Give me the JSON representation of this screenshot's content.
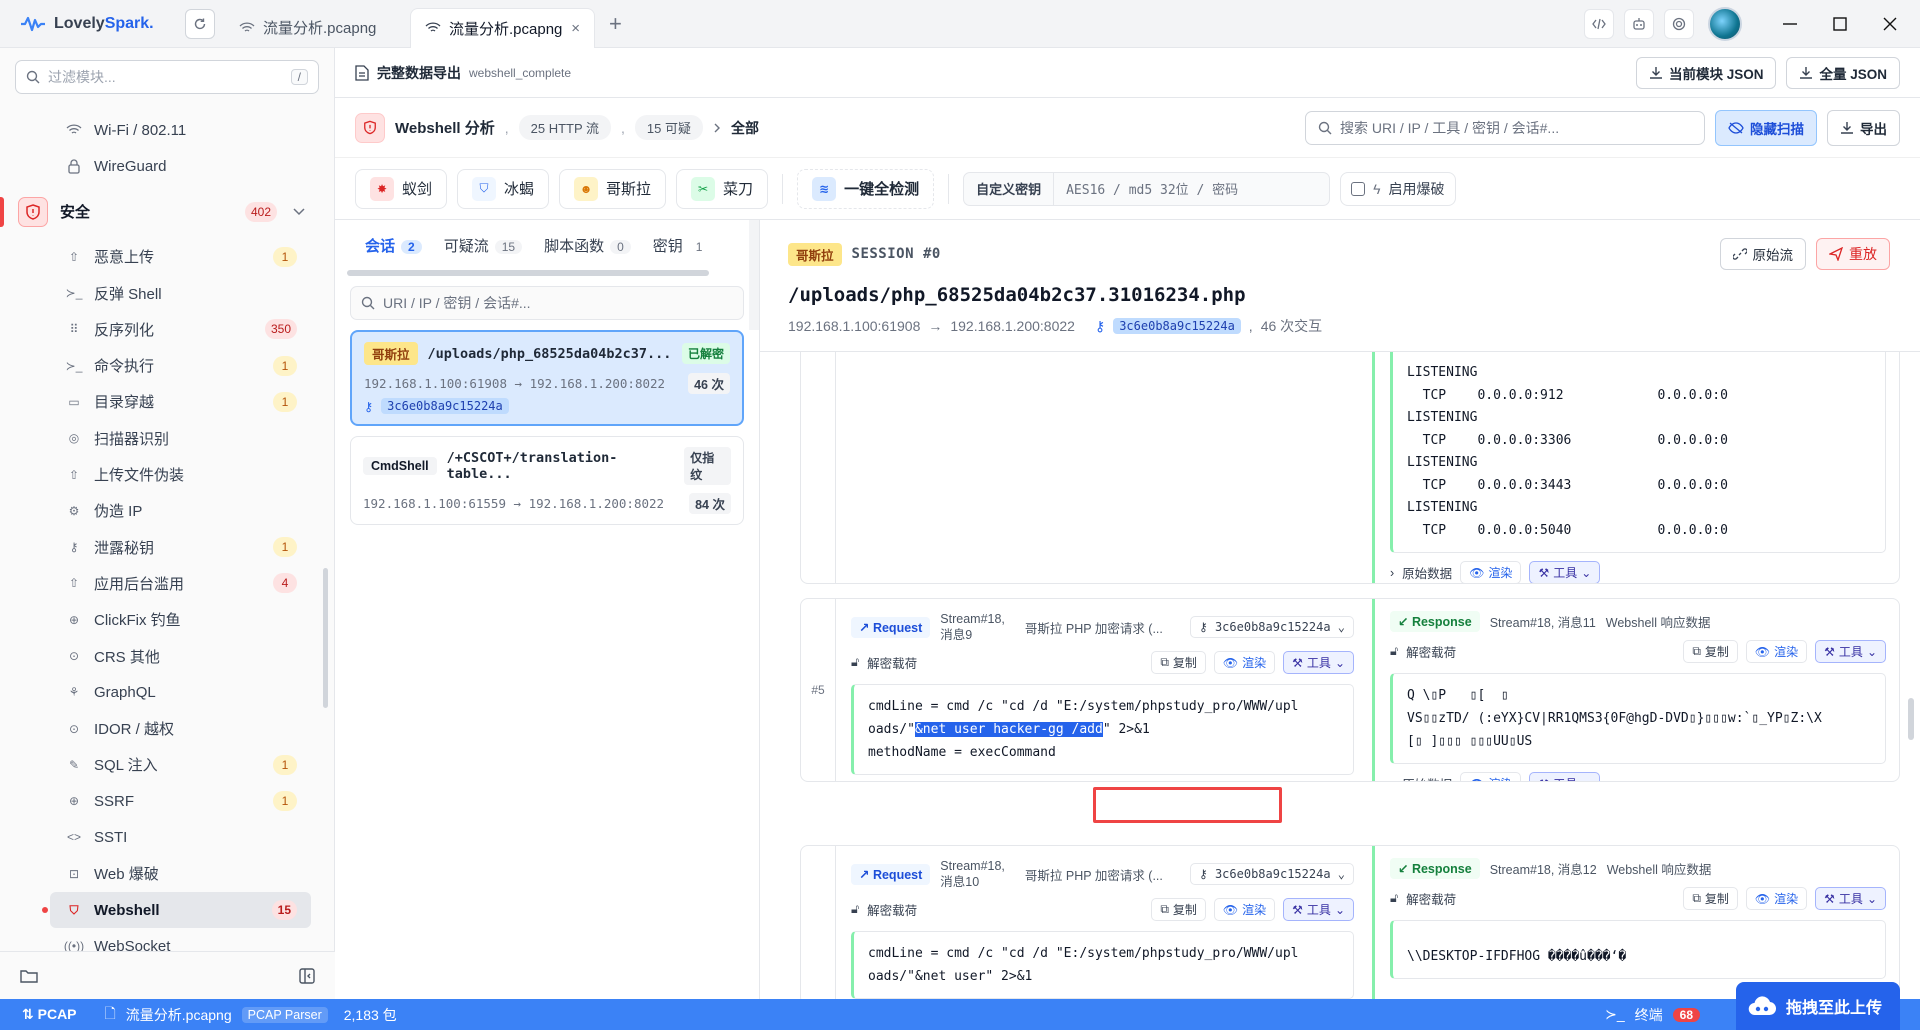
{
  "app": {
    "brand_a": "Lovely",
    "brand_b": "Spark",
    "brand_dot": "."
  },
  "tabs": [
    {
      "label": "流量分析.pcapng"
    },
    {
      "label": "流量分析.pcapng",
      "close": "×"
    }
  ],
  "tab_add": "+",
  "sidebar": {
    "search_placeholder": "过滤模块...",
    "search_kbd": "/",
    "items_top": [
      {
        "label": "Wi-Fi / 802.11",
        "icon": "wifi-icon"
      },
      {
        "label": "WireGuard",
        "icon": "lock-icon"
      }
    ],
    "group": {
      "label": "安全",
      "count": "402"
    },
    "items": [
      {
        "label": "恶意上传",
        "count": "1"
      },
      {
        "label": "反弹 Shell",
        "count": ""
      },
      {
        "label": "反序列化",
        "count": "350"
      },
      {
        "label": "命令执行",
        "count": "1"
      },
      {
        "label": "目录穿越",
        "count": "1"
      },
      {
        "label": "扫描器识别",
        "count": ""
      },
      {
        "label": "上传文件伪装",
        "count": ""
      },
      {
        "label": "伪造 IP",
        "count": ""
      },
      {
        "label": "泄露秘钥",
        "count": "1"
      },
      {
        "label": "应用后台滥用",
        "count": "4"
      },
      {
        "label": "ClickFix 钓鱼",
        "count": ""
      },
      {
        "label": "CRS 其他",
        "count": ""
      },
      {
        "label": "GraphQL",
        "count": ""
      },
      {
        "label": "IDOR / 越权",
        "count": ""
      },
      {
        "label": "SQL 注入",
        "count": "1"
      },
      {
        "label": "SSRF",
        "count": "1"
      },
      {
        "label": "SSTI",
        "count": ""
      },
      {
        "label": "Web 爆破",
        "count": ""
      },
      {
        "label": "Webshell",
        "count": "15"
      },
      {
        "label": "WebSocket",
        "count": ""
      }
    ]
  },
  "export": {
    "title": "完整数据导出",
    "sub": "webshell_complete",
    "btn_current": "当前模块 JSON",
    "btn_all": "全量 JSON"
  },
  "filter": {
    "title": "Webshell 分析",
    "sep": ",",
    "http": "25 HTTP 流",
    "suspicious": "15 可疑",
    "all": "全部",
    "search_placeholder": "搜索 URI / IP / 工具 / 密钥 / 会话#...",
    "hide_scan": "隐藏扫描",
    "export": "导出"
  },
  "tools": {
    "items": [
      "蚁剑",
      "冰蝎",
      "哥斯拉",
      "菜刀"
    ],
    "detect_all": "一键全检测",
    "custom_key": "自定义密钥",
    "key_placeholder": "AES16 / md5 32位 / 密码",
    "brute": "启用爆破"
  },
  "session_tabs": [
    {
      "label": "会话",
      "count": "2"
    },
    {
      "label": "可疑流",
      "count": "15"
    },
    {
      "label": "脚本函数",
      "count": "0"
    },
    {
      "label": "密钥",
      "count": "1"
    }
  ],
  "session_search": "URI / IP / 密钥 / 会话#...",
  "sessions": [
    {
      "tool": "哥斯拉",
      "uri": "/uploads/php_68525da04b2c37...",
      "status": "已解密",
      "src": "192.168.1.100:61908",
      "arrow": "→",
      "dst": "192.168.1.200:8022",
      "count": "46 次",
      "sid": "3c6e0b8a9c15224a"
    },
    {
      "tool": "CmdShell",
      "uri": "/+CSCOT+/translation-table...",
      "status": "仅指纹",
      "src": "192.168.1.100:61559",
      "arrow": "→",
      "dst": "192.168.1.200:8022",
      "count": "84 次"
    }
  ],
  "detail": {
    "tool": "哥斯拉",
    "session_no": "SESSION #0",
    "path": "/uploads/php_68525da04b2c37.31016234.php",
    "src": "192.168.1.100:61908",
    "dst": "192.168.1.200:8022",
    "sid": "3c6e0b8a9c15224a",
    "sep": ",",
    "interactions": "46 次交互",
    "btn_raw": "原始流",
    "btn_replay": "重放"
  },
  "block0": {
    "response_text": "LISTENING\n  TCP    0.0.0.0:912            0.0.0.0:0\nLISTENING\n  TCP    0.0.0.0:3306           0.0.0.0:0\nLISTENING\n  TCP    0.0.0.0:3443           0.0.0.0:0\nLISTENING\n  TCP    0.0.0.0:5040           0.0.0.0:0",
    "raw": "原始数据",
    "render": "渲染",
    "tools": "工具"
  },
  "block1": {
    "index": "#5",
    "req_label": "Request",
    "req_stream_a": "Stream#18,",
    "req_stream_b": "消息9",
    "req_desc": "哥斯拉 PHP 加密请求 (...",
    "sid": "3c6e0b8a9c15224a",
    "decrypted": "解密载荷",
    "copy": "复制",
    "render": "渲染",
    "tools": "工具",
    "code_a": "cmdLine = cmd /c \"cd /d \"E:/system/phpstudy_pro/WWW/upl\noads/\"",
    "code_hl": "&net user hacker-gg /add",
    "code_b": "\" 2>&1\nmethodName = execCommand",
    "raw": "原始数据",
    "res_label": "Response",
    "res_stream": "Stream#18, 消息11",
    "res_desc": "Webshell 响应数据",
    "res_text": "Q \\▯P   ▯[  ▯\nVS▯▯zTD/ (:eYX}CV|RR1QMS3{0F@hgD-DVD▯}▯▯▯w:`▯_YP▯Z:\\X\n[▯ ]▯▯▯ ▯▯▯UU▯US"
  },
  "block2": {
    "req_label": "Request",
    "req_stream_a": "Stream#18,",
    "req_stream_b": "消息10",
    "req_desc": "哥斯拉 PHP 加密请求 (...",
    "sid": "3c6e0b8a9c15224a",
    "decrypted": "解密载荷",
    "copy": "复制",
    "render": "渲染",
    "tools": "工具",
    "code": "cmdLine = cmd /c \"cd /d \"E:/system/phpstudy_pro/WWW/upl\noads/\"&net user\" 2>&1",
    "res_label": "Response",
    "res_stream": "Stream#18, 消息12",
    "res_desc": "Webshell 响应数据",
    "res_text": "\\\\DESKTOP-IFDFHOG ����û���‘�"
  },
  "status": {
    "pcap": "PCAP",
    "file": "流量分析.pcapng",
    "parser": "PCAP Parser",
    "packets": "2,183 包",
    "terminal": "终端",
    "terminal_count": "68",
    "upload": "拖拽至此上传"
  },
  "colors": {
    "accent": "#3b82f6",
    "danger": "#ef4444",
    "success": "#86efac"
  }
}
